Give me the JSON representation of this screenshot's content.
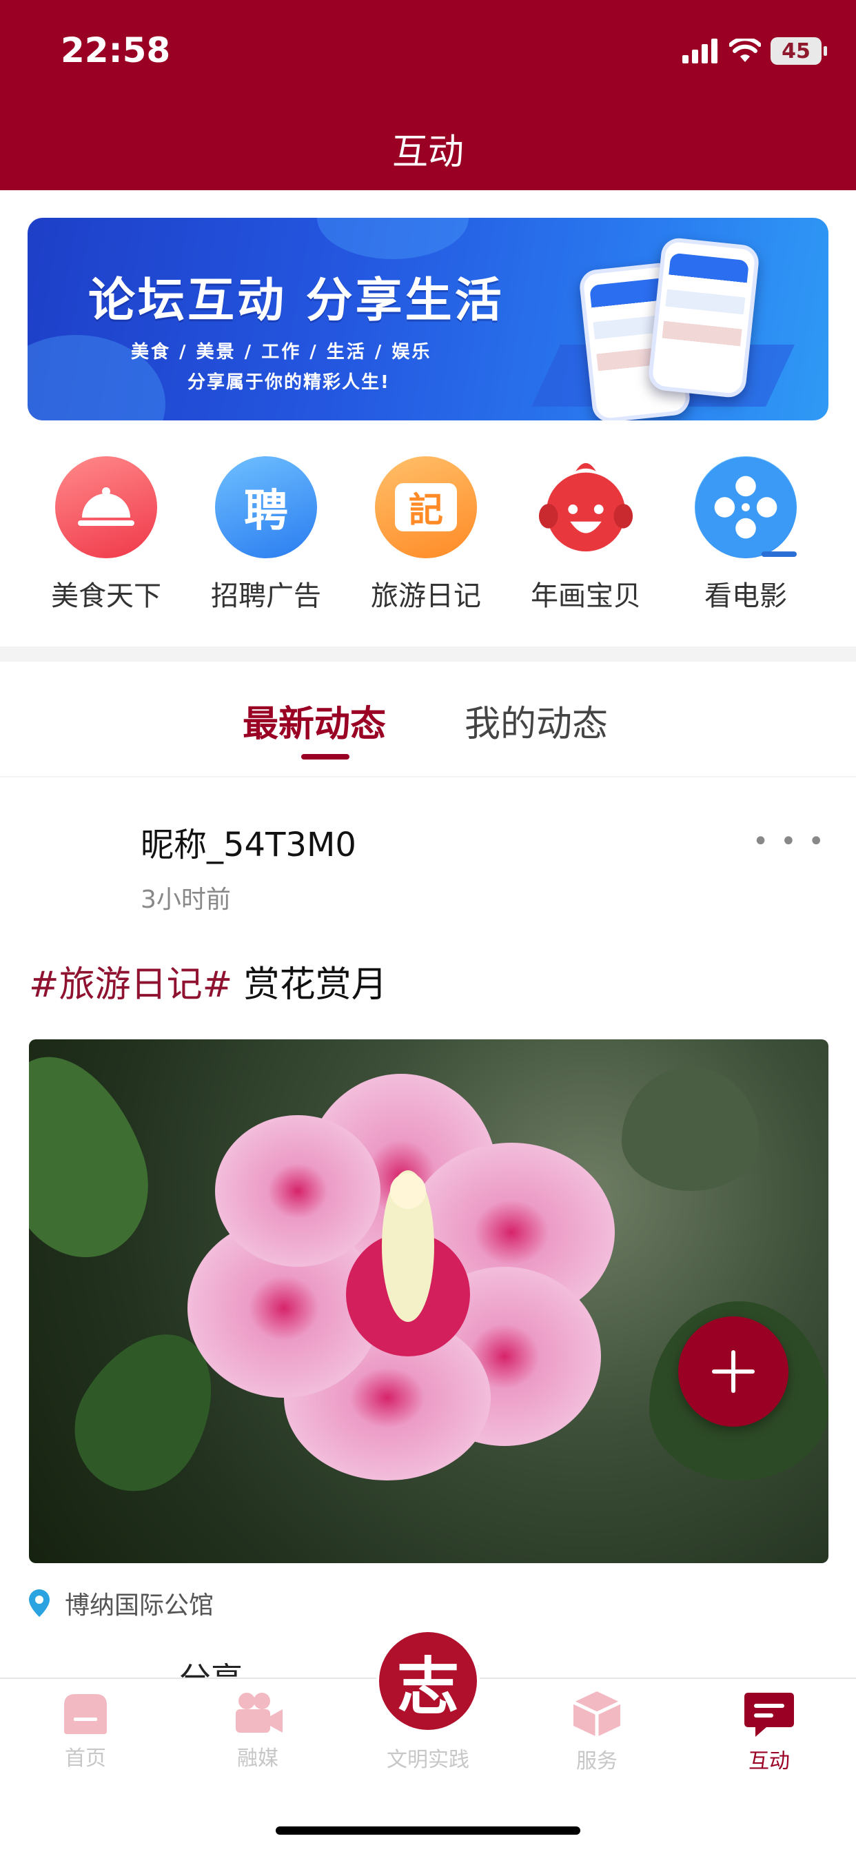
{
  "status_bar": {
    "time": "22:58",
    "battery": "45"
  },
  "header": {
    "title": "互动"
  },
  "banner": {
    "title": "论坛互动  分享生活",
    "subtitle": "美食 / 美景 / 工作 / 生活 / 娱乐",
    "slogan": "分享属于你的精彩人生!"
  },
  "categories": [
    {
      "label": "美食天下",
      "icon": "cloche-icon",
      "glyph": ""
    },
    {
      "label": "招聘广告",
      "icon": "recruit-icon",
      "glyph": "聘"
    },
    {
      "label": "旅游日记",
      "icon": "travel-diary-icon",
      "glyph": "記"
    },
    {
      "label": "年画宝贝",
      "icon": "new-year-doll-icon",
      "glyph": ""
    },
    {
      "label": "看电影",
      "icon": "film-reel-icon",
      "glyph": ""
    }
  ],
  "tabs": {
    "latest": "最新动态",
    "mine": "我的动态"
  },
  "post": {
    "nickname": "昵称_54T3M0",
    "time": "3小时前",
    "hashtag": "#旅游日记#",
    "text": " 赏花赏月",
    "location": "博纳国际公馆",
    "share_peek": "分享"
  },
  "bottom_nav": {
    "items": [
      {
        "label": "首页",
        "icon": "home-icon"
      },
      {
        "label": "融媒",
        "icon": "video-camera-icon"
      },
      {
        "label": "文明实践",
        "icon": "zhi-logo-icon",
        "glyph": "志"
      },
      {
        "label": "服务",
        "icon": "service-box-icon"
      },
      {
        "label": "互动",
        "icon": "chat-icon"
      }
    ],
    "active": "互动"
  },
  "colors": {
    "brand": "#990024",
    "banner": "#2457e0",
    "inactive": "#c7c7c7"
  }
}
